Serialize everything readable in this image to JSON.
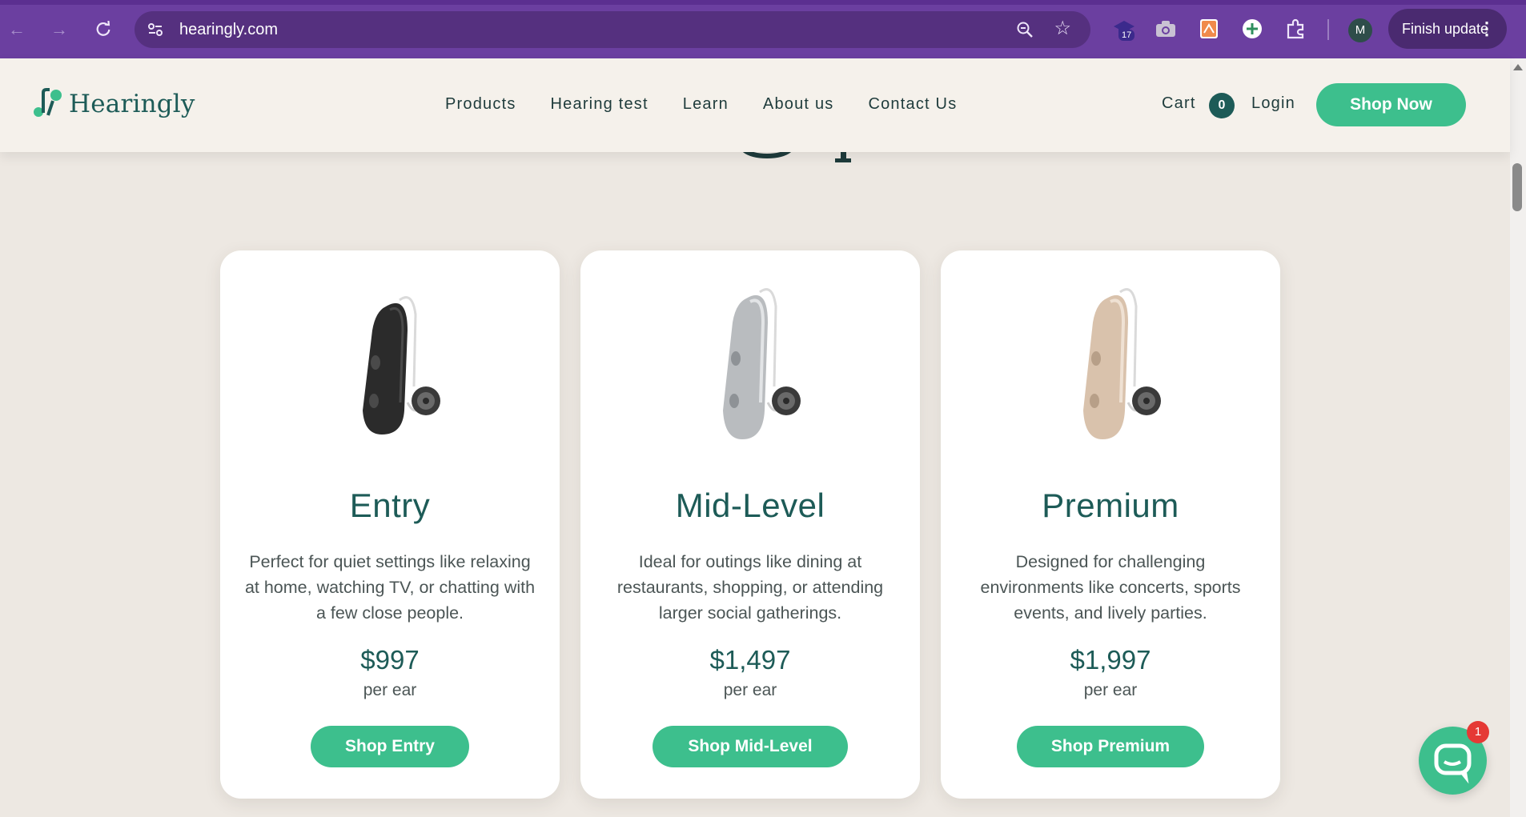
{
  "browser": {
    "url": "hearingly.com",
    "extension_badge": "17",
    "profile_initial": "M",
    "update_label": "Finish update"
  },
  "site": {
    "brand": "Hearingly",
    "nav": [
      "Products",
      "Hearing test",
      "Learn",
      "About us",
      "Contact Us"
    ],
    "cart_label": "Cart",
    "cart_count": "0",
    "login_label": "Login",
    "shop_now_label": "Shop Now"
  },
  "products": [
    {
      "tier": "Entry",
      "description": "Perfect for quiet settings like relaxing at home, watching TV, or chatting with a few close people.",
      "price": "$997",
      "unit": "per ear",
      "button": "Shop Entry",
      "device_color": "black"
    },
    {
      "tier": "Mid-Level",
      "description": "Ideal for outings like dining at restaurants, shopping, or attending larger social gatherings.",
      "price": "$1,497",
      "unit": "per ear",
      "button": "Shop Mid-Level",
      "device_color": "silver"
    },
    {
      "tier": "Premium",
      "description": "Designed for challenging environments like concerts, sports events, and lively parties.",
      "price": "$1,997",
      "unit": "per ear",
      "button": "Shop Premium",
      "device_color": "champagne"
    }
  ],
  "chat": {
    "badge": "1"
  },
  "colors": {
    "browser_frame": "#6b3fa0",
    "page_bg": "#ede8e2",
    "header_bg": "#f5f1eb",
    "brand_green": "#3dbf8d",
    "brand_teal": "#1d5b57"
  }
}
